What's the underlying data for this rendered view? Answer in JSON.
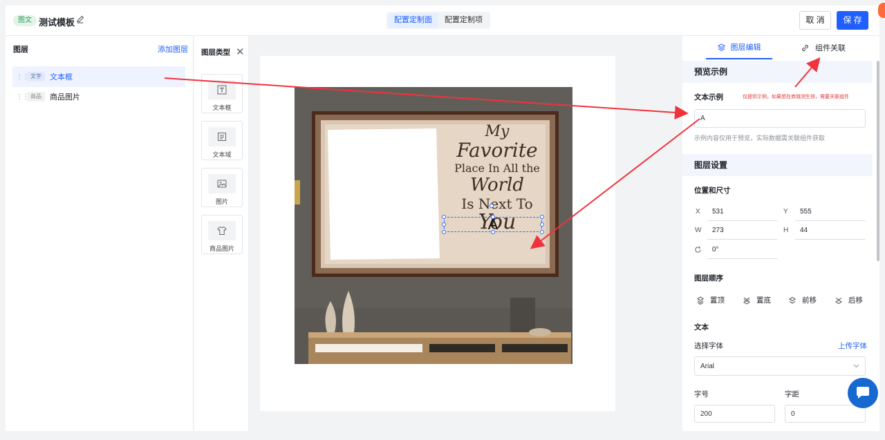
{
  "header": {
    "tag": "图文",
    "template_title": "测试模板",
    "tabs": [
      "配置定制面",
      "配置定制项"
    ],
    "cancel": "取 消",
    "save": "保 存"
  },
  "layers": {
    "title": "图层",
    "add": "添加图层",
    "items": [
      {
        "tag": "文字",
        "name": "文本框"
      },
      {
        "tag": "商品",
        "name": "商品图片"
      }
    ]
  },
  "layer_types": {
    "title": "图层类型",
    "items": [
      "文本框",
      "文本域",
      "图片",
      "商品图片"
    ]
  },
  "canvas": {
    "artwork_lines": [
      "My",
      "Favorite",
      "Place In All the",
      "World",
      "Is Next To",
      "You"
    ],
    "selected_text": "A"
  },
  "panel": {
    "tabs": [
      "图层编辑",
      "组件关联"
    ],
    "preview_section": "预览示例",
    "text_example_label": "文本示例",
    "text_example_hint": "仅提供示例，如果想在商城测生效，需要关联组件",
    "text_example_value": "A",
    "text_example_note": "示例内容仅用于预览，实际数据需关联组件获取",
    "layer_settings_section": "图层设置",
    "pos_size_label": "位置和尺寸",
    "x_label": "X",
    "x_value": "531",
    "y_label": "Y",
    "y_value": "555",
    "w_label": "W",
    "w_value": "273",
    "h_label": "H",
    "h_value": "44",
    "rotation_value": "0°",
    "order_label": "图层顺序",
    "order_buttons": [
      "置顶",
      "置底",
      "前移",
      "后移"
    ],
    "text_label": "文本",
    "font_label": "选择字体",
    "upload_font": "上传字体",
    "font_value": "Arial",
    "size_label": "字号",
    "size_value": "200",
    "spacing_label": "字距",
    "spacing_value": "0"
  },
  "colors": {
    "accent": "#1f5fff",
    "annotation_arrow": "#f0323c",
    "hint_red": "#e03737"
  }
}
